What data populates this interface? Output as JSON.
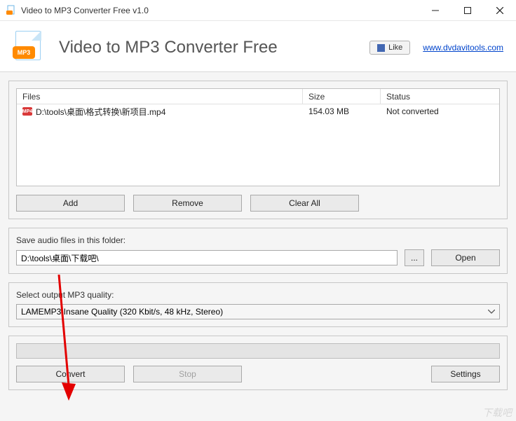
{
  "window": {
    "title": "Video to MP3 Converter Free v1.0",
    "app_name": "Video to MP3 Converter Free",
    "like_label": "Like",
    "site_url_label": "www.dvdavitools.com"
  },
  "filelist": {
    "headers": {
      "files": "Files",
      "size": "Size",
      "status": "Status"
    },
    "rows": [
      {
        "icon": "mp4-icon",
        "path": "D:\\tools\\桌面\\格式转换\\新项目.mp4",
        "size": "154.03 MB",
        "status": "Not converted"
      }
    ],
    "buttons": {
      "add": "Add",
      "remove": "Remove",
      "clear": "Clear All"
    }
  },
  "output": {
    "label": "Save audio files in this folder:",
    "path": "D:\\tools\\桌面\\下载吧\\",
    "browse": "...",
    "open": "Open"
  },
  "quality": {
    "label": "Select output MP3 quality:",
    "selected": "LAMEMP3 Insane Quality (320 Kbit/s, 48 kHz, Stereo)"
  },
  "actions": {
    "convert": "Convert",
    "stop": "Stop",
    "settings": "Settings"
  },
  "watermark": "下载吧"
}
